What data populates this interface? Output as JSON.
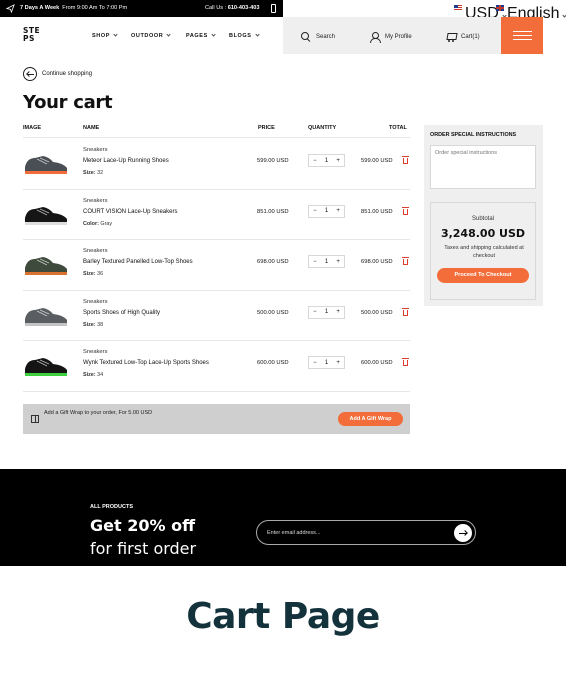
{
  "topbar": {
    "promo_bold": "7 Days A Week",
    "promo_text": "From 9:00 Am To 7:00 Pm",
    "call_label": "Call Us :",
    "call_number": "610-403-403",
    "currency": "USD",
    "language": "English"
  },
  "header": {
    "logo_line1": "STE",
    "logo_line2": "PS",
    "nav": [
      "SHOP",
      "OUTDOOR",
      "PAGES",
      "BLOGS"
    ],
    "search_label": "Search",
    "profile_label": "My Profile",
    "cart_label": "Cart(1)"
  },
  "page": {
    "continue_label": "Continue shopping",
    "title": "Your cart"
  },
  "table": {
    "headers": {
      "image": "IMAGE",
      "name": "NAME",
      "price": "PRICE",
      "quantity": "QUANTITY",
      "total": "TOTAL"
    },
    "rows": [
      {
        "category": "Sneakers",
        "name": "Meteor Lace-Up Running Shoes",
        "meta_label": "Size:",
        "meta_value": "32",
        "price": "599.00 USD",
        "qty": "1",
        "total": "599.00 USD",
        "shoe_color": "#4a4f55",
        "accent": "#f26d3a"
      },
      {
        "category": "Sneakers",
        "name": "COURT VISION Lace-Up Sneakers",
        "meta_label": "Color:",
        "meta_value": "Gray",
        "price": "851.00 USD",
        "qty": "1",
        "total": "851.00 USD",
        "shoe_color": "#151515",
        "accent": "#dddddd"
      },
      {
        "category": "Sneakers",
        "name": "Barley Textured Panelled Low-Top Shoes",
        "meta_label": "Size:",
        "meta_value": "36",
        "price": "698.00 USD",
        "qty": "1",
        "total": "698.00 USD",
        "shoe_color": "#3e4a3b",
        "accent": "#d9722e"
      },
      {
        "category": "Sneakers",
        "name": "Sports Shoes of High Quality",
        "meta_label": "Size:",
        "meta_value": "38",
        "price": "500.00 USD",
        "qty": "1",
        "total": "500.00 USD",
        "shoe_color": "#5a5d61",
        "accent": "#c4c4c4"
      },
      {
        "category": "Sneakers",
        "name": "Wynk Textured Low-Top Lace-Up Sports Shoes",
        "meta_label": "Size:",
        "meta_value": "34",
        "price": "600.00 USD",
        "qty": "1",
        "total": "600.00 USD",
        "shoe_color": "#141414",
        "accent": "#3ecf3e"
      }
    ],
    "qty_minus": "−",
    "qty_plus": "+"
  },
  "gift": {
    "text": "Add a Gift Wrap to your order, For 5.00 USD",
    "button": "Add A Gift Wrap"
  },
  "sidebar": {
    "title": "ORDER SPECIAL INSTRUCTIONS",
    "placeholder": "Order special instructions",
    "subtotal_label": "Subtotal",
    "subtotal_amount": "3,248.00 USD",
    "tax_note": "Taxes and shipping calculated at checkout",
    "checkout_button": "Proceed To Checkout"
  },
  "newsletter": {
    "label": "ALL PRODUCTS",
    "headline": "Get 20% off",
    "subheadline": "for first order",
    "email_placeholder": "Enter email address..."
  },
  "footer_caption": "Cart Page",
  "colors": {
    "accent": "#f26d3a",
    "caption": "#14323c"
  }
}
